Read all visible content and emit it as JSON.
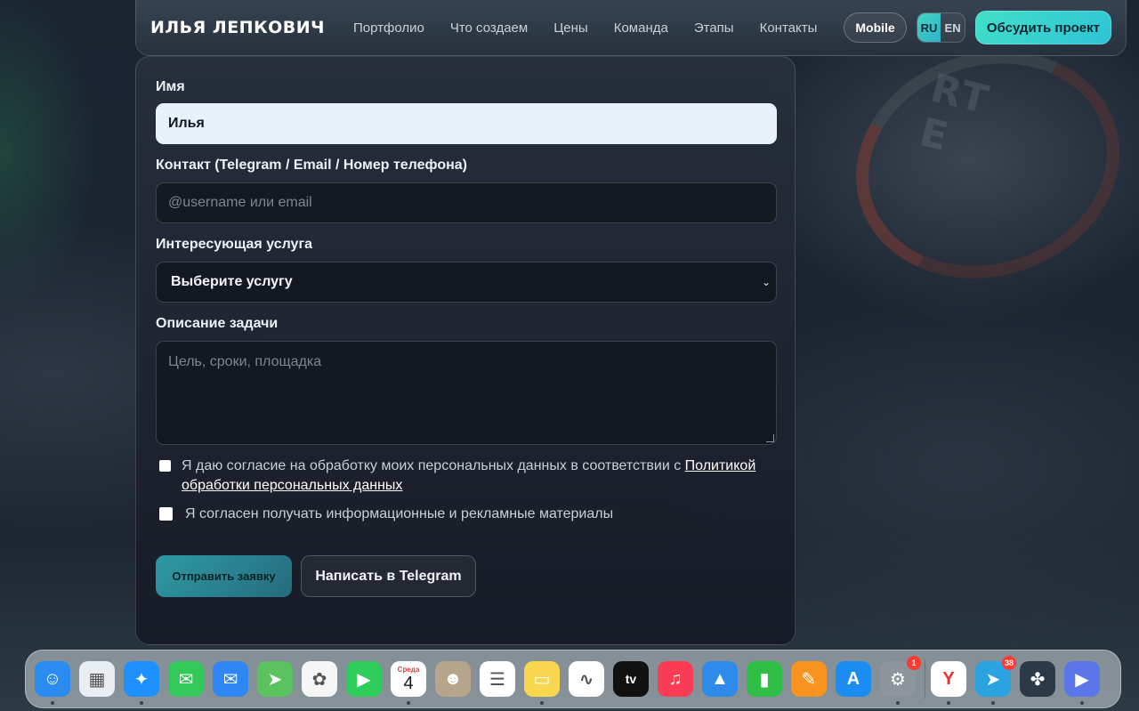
{
  "header": {
    "logo": "ИЛЬЯ ЛЕПКОВИЧ",
    "nav": [
      "Портфолио",
      "Что создаем",
      "Цены",
      "Команда",
      "Этапы",
      "Контакты"
    ],
    "mobile_label": "Mobile",
    "lang_ru": "RU",
    "lang_en": "EN",
    "lang_active": "RU",
    "cta_label": "Обсудить проект"
  },
  "form": {
    "name_label": "Имя",
    "name_value": "Илья",
    "contact_label": "Контакт (Telegram / Email / Номер телефона)",
    "contact_placeholder": "@username или email",
    "service_label": "Интересующая услуга",
    "service_value": "Выберите услугу",
    "desc_label": "Описание задачи",
    "desc_placeholder": "Цель, сроки, площадка",
    "consent1_text": "Я даю согласие на обработку моих персональных данных в соответствии с ",
    "consent1_link": "Политикой обработки персональных данных",
    "consent2_text": "Я согласен получать информационные и рекламные материалы",
    "submit_label": "Отправить заявку",
    "telegram_label": "Написать в Telegram"
  },
  "dock": {
    "calendar_month": "Среда",
    "calendar_day": "4",
    "settings_badge": "1",
    "telegram_badge": "38",
    "items": [
      {
        "icon": "finder-icon",
        "color": "#2a8cf0"
      },
      {
        "icon": "launchpad-icon",
        "color": "#e9eef3"
      },
      {
        "icon": "safari-icon",
        "color": "#1e90ff"
      },
      {
        "icon": "messages-icon",
        "color": "#34c759"
      },
      {
        "icon": "mail-icon",
        "color": "#2f86f5"
      },
      {
        "icon": "maps-icon",
        "color": "#5ac35f"
      },
      {
        "icon": "photos-icon",
        "color": "#f6f6f6"
      },
      {
        "icon": "facetime-icon",
        "color": "#2ecc5a"
      },
      {
        "icon": "calendar-icon",
        "color": "#ffffff"
      },
      {
        "icon": "contacts-icon",
        "color": "#b7a48c"
      },
      {
        "icon": "reminders-icon",
        "color": "#ffffff"
      },
      {
        "icon": "notes-icon",
        "color": "#f8d64e"
      },
      {
        "icon": "freeform-icon",
        "color": "#ffffff"
      },
      {
        "icon": "apple-tv-icon",
        "color": "#111111"
      },
      {
        "icon": "music-icon",
        "color": "#fa3d55"
      },
      {
        "icon": "keynote-icon",
        "color": "#2f8bea"
      },
      {
        "icon": "numbers-icon",
        "color": "#2fbf47"
      },
      {
        "icon": "pages-icon",
        "color": "#f7931e"
      },
      {
        "icon": "app-store-icon",
        "color": "#1b8cf2"
      },
      {
        "icon": "system-settings-icon",
        "color": "#8e959c"
      },
      {
        "icon": "yandex-browser-icon",
        "color": "#ffffff"
      },
      {
        "icon": "telegram-icon",
        "color": "#2aa3e0"
      },
      {
        "icon": "app-icon",
        "color": "#2c3a48"
      },
      {
        "icon": "app-icon-2",
        "color": "#5b76e8"
      }
    ]
  }
}
